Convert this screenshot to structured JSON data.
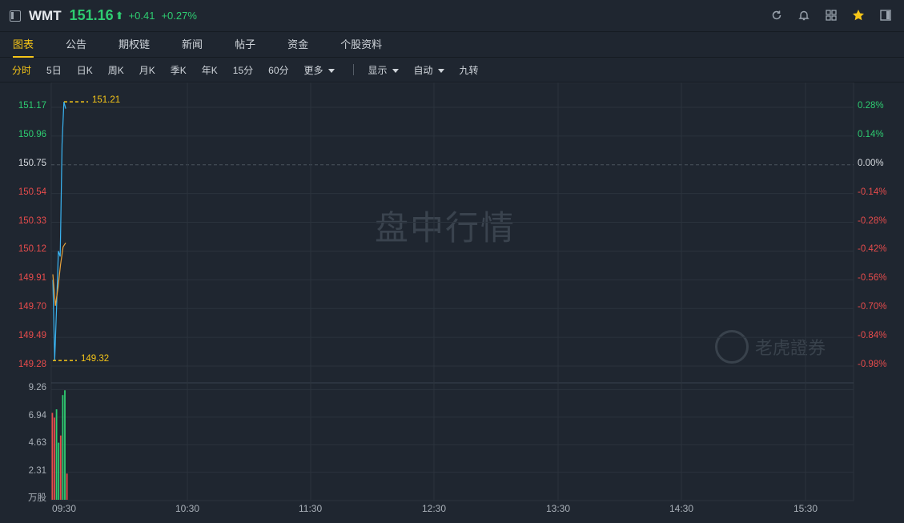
{
  "header": {
    "ticker": "WMT",
    "price": "151.16",
    "arrow": "⬆",
    "change": "+0.41",
    "change_pct": "+0.27%"
  },
  "tabs": [
    "图表",
    "公告",
    "期权链",
    "新闻",
    "帖子",
    "资金",
    "个股资料"
  ],
  "toolbar": {
    "periods": [
      "分时",
      "5日",
      "日K",
      "周K",
      "月K",
      "季K",
      "年K",
      "15分",
      "60分"
    ],
    "more": "更多",
    "display": "显示",
    "auto": "自动",
    "adjust": "九转"
  },
  "watermark": "盘中行情",
  "brand": "老虎證券",
  "chart_data": {
    "type": "line",
    "price_axis": [
      "151.17",
      "150.96",
      "150.75",
      "150.54",
      "150.33",
      "150.12",
      "149.91",
      "149.70",
      "149.49",
      "149.28"
    ],
    "pct_axis": [
      "0.28%",
      "0.14%",
      "0.00%",
      "-0.14%",
      "-0.28%",
      "-0.42%",
      "-0.56%",
      "-0.70%",
      "-0.84%",
      "-0.98%"
    ],
    "volume_axis": [
      "9.26",
      "6.94",
      "4.63",
      "2.31"
    ],
    "volume_unit": "万股",
    "time_axis": [
      "09:30",
      "10:30",
      "11:30",
      "12:30",
      "13:30",
      "14:30",
      "15:30"
    ],
    "prev_close": 150.75,
    "high_label": "151.21",
    "low_label": "149.32",
    "ylim": [
      149.28,
      151.17
    ],
    "price_series": [
      149.91,
      149.32,
      149.7,
      150.12,
      150.08,
      150.9,
      151.21,
      151.16
    ],
    "avg_series": [
      149.95,
      149.72,
      149.85,
      150.02,
      150.15,
      150.18
    ],
    "volume": [
      {
        "v": 7.3,
        "c": "red"
      },
      {
        "v": 6.9,
        "c": "red"
      },
      {
        "v": 7.6,
        "c": "green"
      },
      {
        "v": 4.8,
        "c": "green"
      },
      {
        "v": 5.4,
        "c": "red"
      },
      {
        "v": 8.8,
        "c": "green"
      },
      {
        "v": 9.2,
        "c": "green"
      },
      {
        "v": 2.2,
        "c": "red"
      }
    ],
    "colors": {
      "up": "#2ecc71",
      "down": "#e74c4c",
      "price_line": "#3ab4f2",
      "avg_line": "#e8a33d",
      "annot": "#f5c518",
      "grid": "#2b333d"
    }
  }
}
